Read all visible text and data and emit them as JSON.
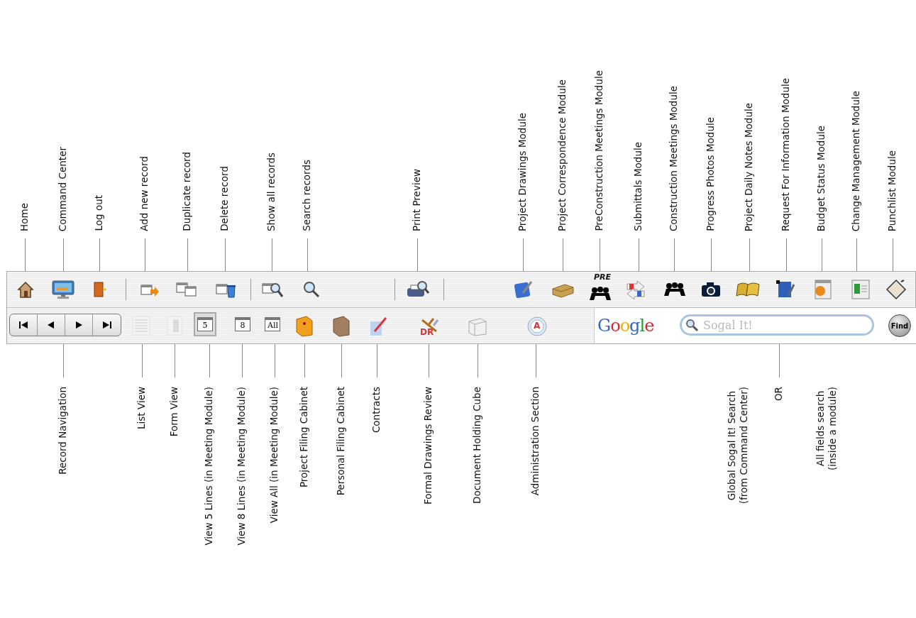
{
  "top_labels": [
    "Home",
    "Command Center",
    "Log out",
    "Add new record",
    "Duplicate record",
    "Delete record",
    "Show all records",
    "Search records",
    "Print Preview",
    "Project Drawings Module",
    "Project Correspondence Module",
    "PreConstruction Meetings Module",
    "Submittals Module",
    "Construction Meetings Module",
    "Progress Photos Module",
    "Project Daily Notes Module",
    "Request For Information Module",
    "Budget Status Module",
    "Change Management Module",
    "Punchlist Module"
  ],
  "toolbar": {
    "preconstruction_badge": "PRE",
    "list_view": {
      "disabled": true
    },
    "form_view": {
      "disabled": true
    },
    "view_buttons": [
      {
        "label": "5",
        "selected": true
      },
      {
        "label": "8",
        "selected": false
      },
      {
        "label": "All",
        "selected": false
      }
    ],
    "drawing_review_badge": "DR",
    "admin_badge": "A",
    "google_logo": "Google",
    "search": {
      "placeholder": "Sogal It!"
    },
    "find_button": "Find"
  },
  "bottom_labels": [
    "Record Navigation",
    "List View",
    "Form View",
    "View 5 Lines (in Meeting Module)",
    "View 8 Lines (in Meeting Module)",
    "View All (in Meeting Module)",
    "Project Filing Cabinet",
    "Personal Filing Cabinet",
    "Contracts",
    "Formal Drawings Review",
    "Document Holding Cube",
    "Administration Section",
    "Global Sogal It! Search\n(from Command Center)",
    "OR",
    "All fields search\n(inside a module)"
  ]
}
